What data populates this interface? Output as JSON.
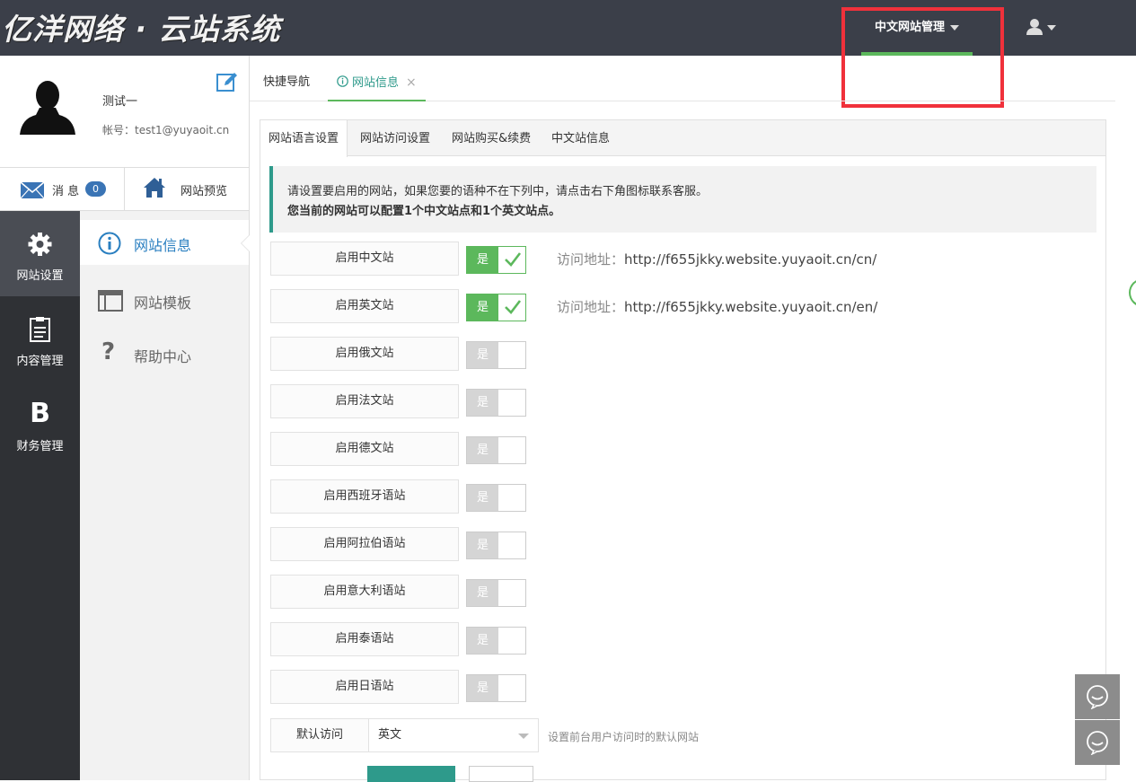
{
  "header": {
    "logo": "亿洋网络 · 云站系统",
    "site_manager": "中文网站管理"
  },
  "profile": {
    "name": "测试一",
    "account": "帐号：test1@yuyaoit.cn"
  },
  "quickbar": {
    "messages_label": "消 息",
    "messages_count": "0",
    "preview_label": "网站预览"
  },
  "leftnav": [
    {
      "label": "网站设置",
      "icon": "gear-icon"
    },
    {
      "label": "内容管理",
      "icon": "clipboard-icon"
    },
    {
      "label": "财务管理",
      "icon": "b-icon"
    }
  ],
  "subnav": [
    {
      "label": "网站信息",
      "icon": "info-icon"
    },
    {
      "label": "网站模板",
      "icon": "window-icon"
    },
    {
      "label": "帮助中心",
      "icon": "question-icon"
    }
  ],
  "tabs": [
    {
      "label": "快捷导航"
    },
    {
      "label": "网站信息",
      "close": "×"
    }
  ],
  "panel_tabs": [
    "网站语言设置",
    "网站访问设置",
    "网站购买&续费",
    "中文站信息"
  ],
  "notice": {
    "line1": "请设置要启用的网站，如果您要的语种不在下列中，请点击右下角图标联系客服。",
    "line2": "您当前的网站可以配置1个中文站点和1个英文站点。"
  },
  "toggle_yes": "是",
  "url_prefix": "访问地址：",
  "sites": [
    {
      "label": "启用中文站",
      "on": true,
      "url": "http://f655jkky.website.yuyaoit.cn/cn/"
    },
    {
      "label": "启用英文站",
      "on": true,
      "url": "http://f655jkky.website.yuyaoit.cn/en/"
    },
    {
      "label": "启用俄文站",
      "on": false
    },
    {
      "label": "启用法文站",
      "on": false
    },
    {
      "label": "启用德文站",
      "on": false
    },
    {
      "label": "启用西班牙语站",
      "on": false
    },
    {
      "label": "启用阿拉伯语站",
      "on": false
    },
    {
      "label": "启用意大利语站",
      "on": false
    },
    {
      "label": "启用泰语站",
      "on": false
    },
    {
      "label": "启用日语站",
      "on": false
    }
  ],
  "default_access": {
    "label": "默认访问",
    "value": "英文",
    "hint": "设置前台用户访问时的默认网站"
  },
  "colors": {
    "accent": "#2e9a8b",
    "toggle_on": "#5cb85c",
    "topbar": "#3b3f49",
    "highlight_box": "#f0313b"
  }
}
